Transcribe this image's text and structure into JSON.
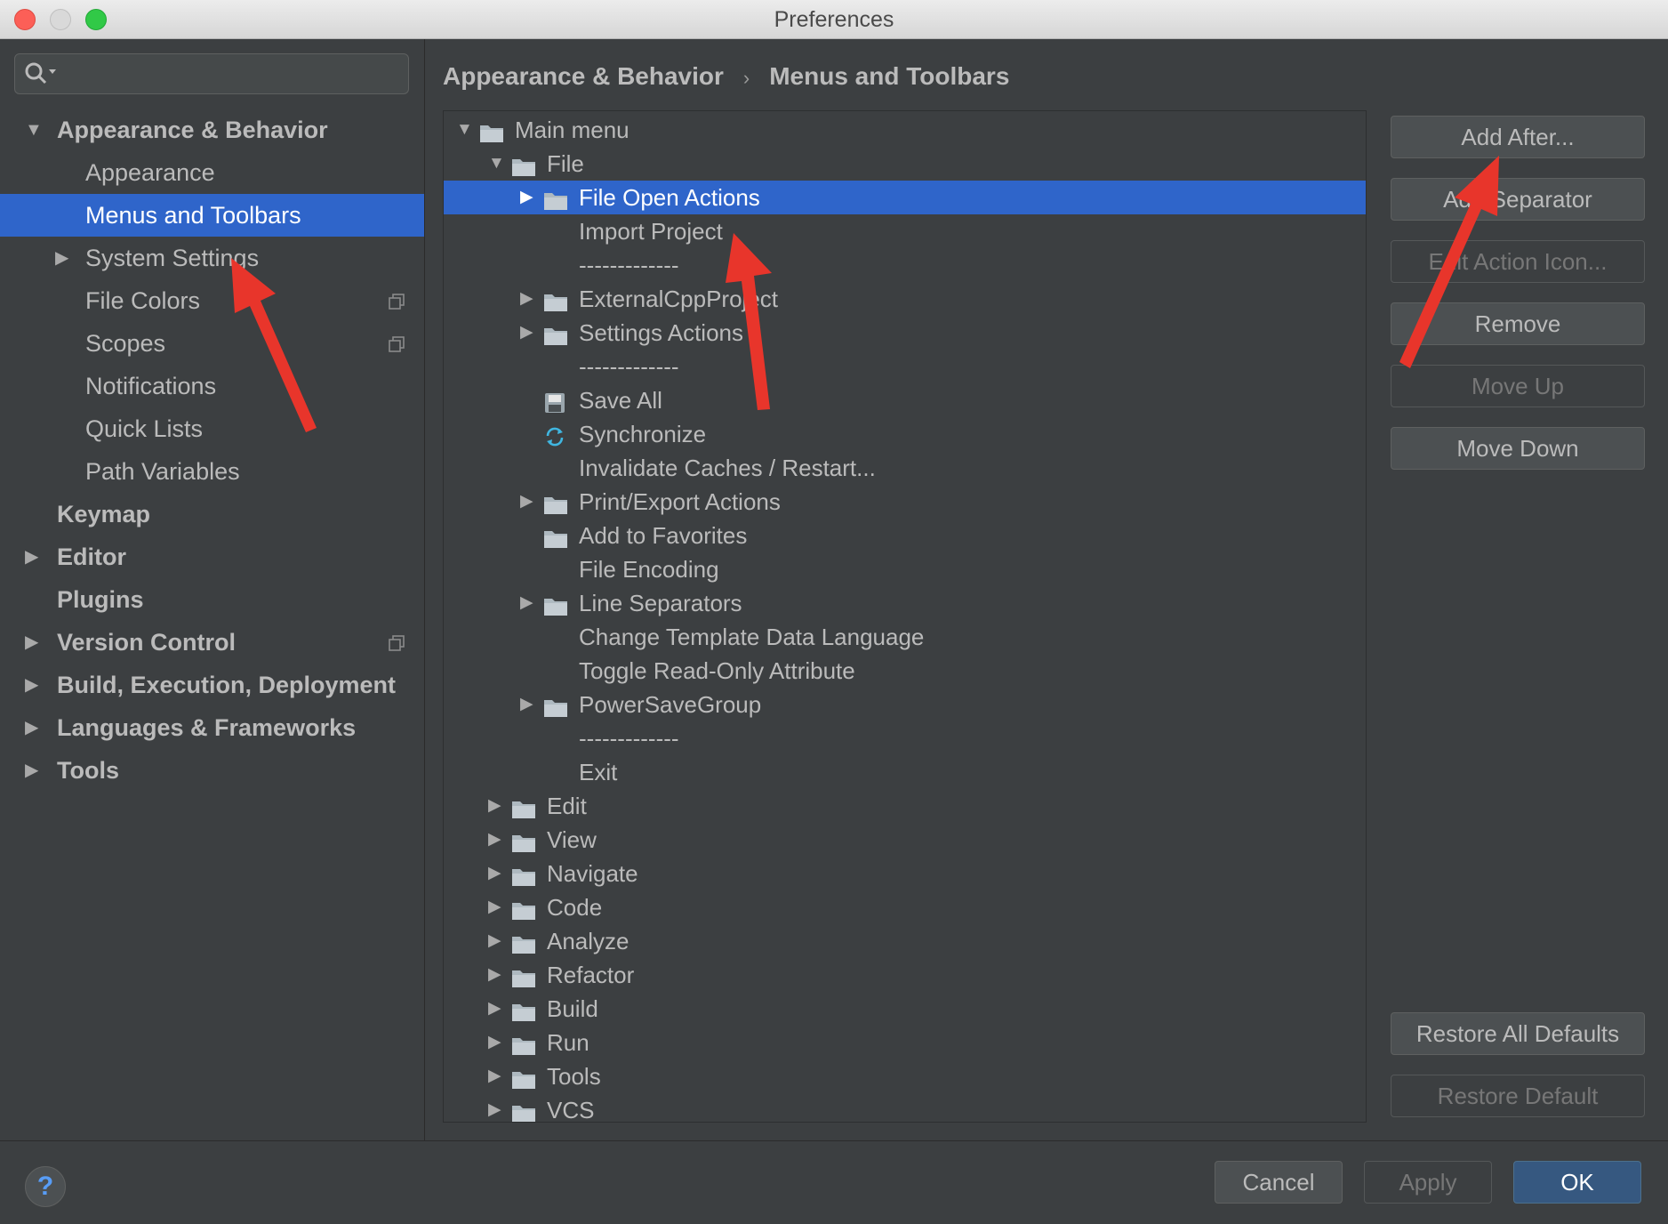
{
  "window": {
    "title": "Preferences"
  },
  "search": {
    "value": "",
    "placeholder": ""
  },
  "sidebar": {
    "items": [
      {
        "label": "Appearance & Behavior"
      },
      {
        "label": "Appearance"
      },
      {
        "label": "Menus and Toolbars"
      },
      {
        "label": "System Settings"
      },
      {
        "label": "File Colors"
      },
      {
        "label": "Scopes"
      },
      {
        "label": "Notifications"
      },
      {
        "label": "Quick Lists"
      },
      {
        "label": "Path Variables"
      },
      {
        "label": "Keymap"
      },
      {
        "label": "Editor"
      },
      {
        "label": "Plugins"
      },
      {
        "label": "Version Control"
      },
      {
        "label": "Build, Execution, Deployment"
      },
      {
        "label": "Languages & Frameworks"
      },
      {
        "label": "Tools"
      }
    ]
  },
  "breadcrumb": {
    "parent": "Appearance & Behavior",
    "separator": "›",
    "current": "Menus and Toolbars"
  },
  "tree": {
    "rows": [
      {
        "label": "Main menu"
      },
      {
        "label": "File"
      },
      {
        "label": "File Open Actions"
      },
      {
        "label": "Import Project"
      },
      {
        "label": "-------------"
      },
      {
        "label": "ExternalCppProject"
      },
      {
        "label": "Settings Actions"
      },
      {
        "label": "-------------"
      },
      {
        "label": "Save All"
      },
      {
        "label": "Synchronize"
      },
      {
        "label": "Invalidate Caches / Restart..."
      },
      {
        "label": "Print/Export Actions"
      },
      {
        "label": "Add to Favorites"
      },
      {
        "label": "File Encoding"
      },
      {
        "label": "Line Separators"
      },
      {
        "label": "Change Template Data Language"
      },
      {
        "label": "Toggle Read-Only Attribute"
      },
      {
        "label": "PowerSaveGroup"
      },
      {
        "label": "-------------"
      },
      {
        "label": "Exit"
      },
      {
        "label": "Edit"
      },
      {
        "label": "View"
      },
      {
        "label": "Navigate"
      },
      {
        "label": "Code"
      },
      {
        "label": "Analyze"
      },
      {
        "label": "Refactor"
      },
      {
        "label": "Build"
      },
      {
        "label": "Run"
      },
      {
        "label": "Tools"
      },
      {
        "label": "VCS"
      }
    ]
  },
  "actions": {
    "add_after": "Add After...",
    "add_separator": "Add Separator",
    "edit_action_icon": "Edit Action Icon...",
    "remove": "Remove",
    "move_up": "Move Up",
    "move_down": "Move Down",
    "restore_all_defaults": "Restore All Defaults",
    "restore_default": "Restore Default"
  },
  "footer": {
    "help": "?",
    "cancel": "Cancel",
    "apply": "Apply",
    "ok": "OK"
  },
  "colors": {
    "background": "#3c3f41",
    "selection": "#2f65ca",
    "default_button": "#365880",
    "annotation_arrow": "#e8352b"
  },
  "icons": {
    "search": "search-icon",
    "folder": "folder-icon",
    "save": "save-all-icon",
    "sync": "synchronize-icon",
    "project_scope": "copy-icon",
    "help": "help-icon"
  }
}
